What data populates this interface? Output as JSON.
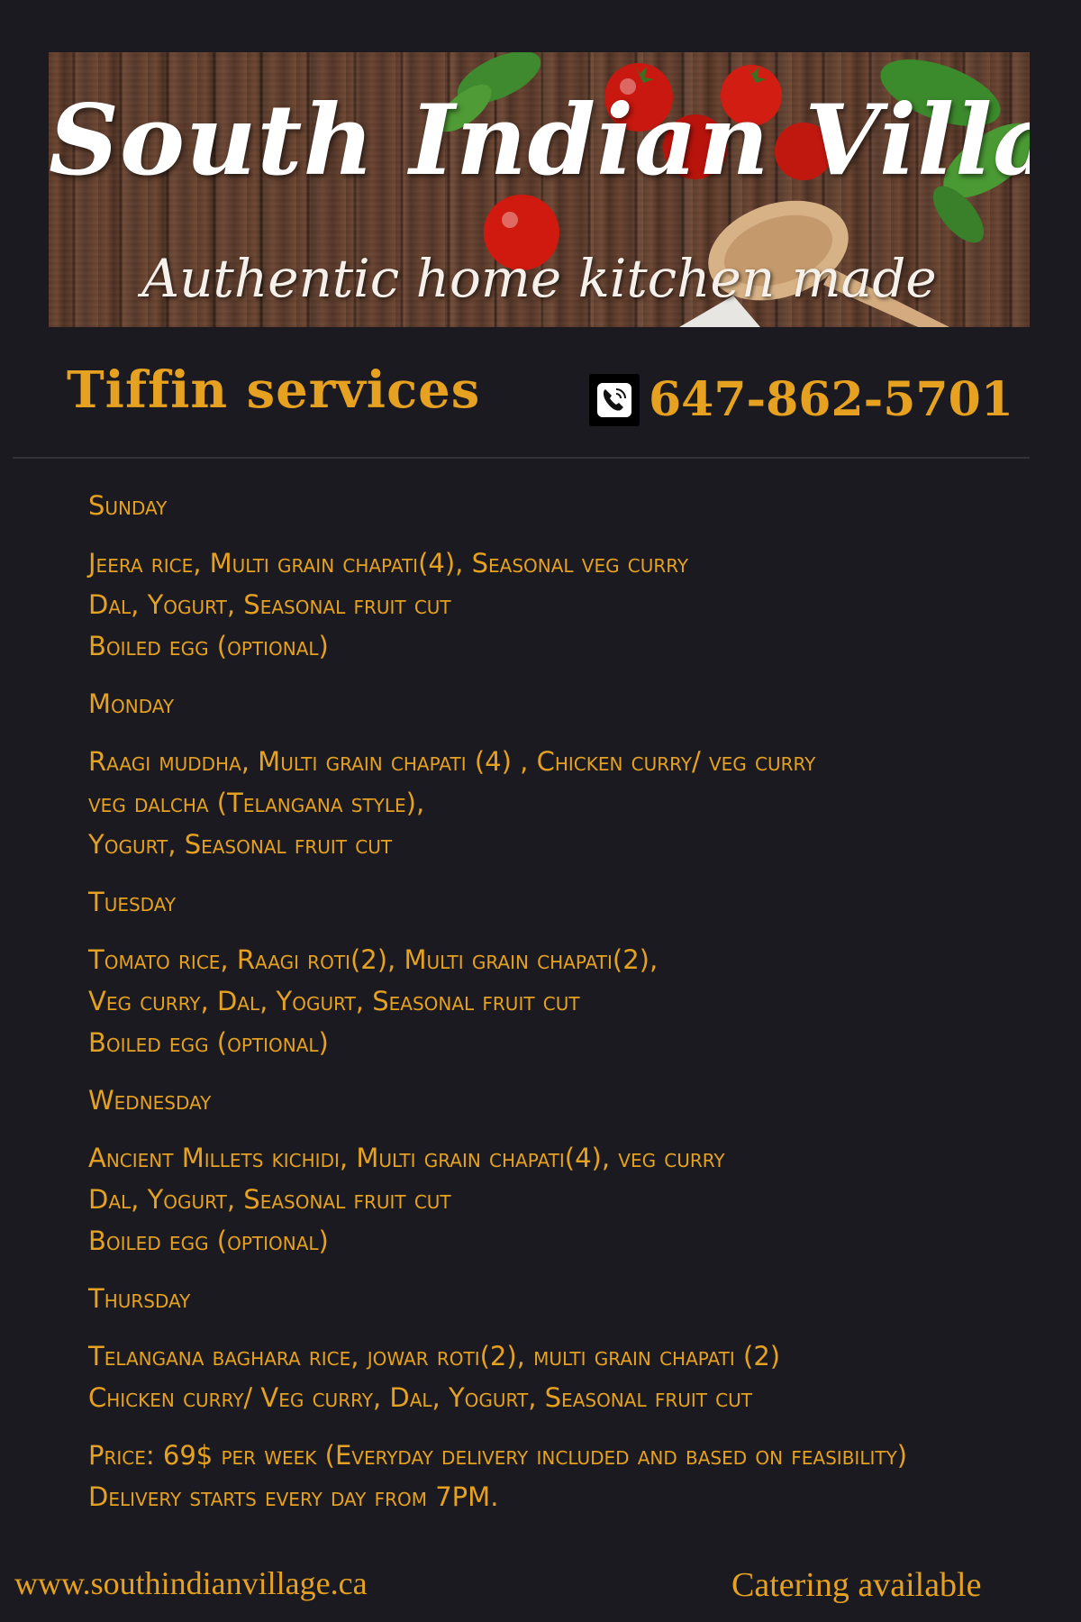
{
  "banner": {
    "title": "South Indian Village",
    "subtitle": "Authentic home kitchen made"
  },
  "header": {
    "service_title": "Tiffin services",
    "phone_number": "647-862-5701",
    "phone_icon": "phone-icon"
  },
  "menu": {
    "days": [
      {
        "name": "Sunday",
        "lines": [
          "Jeera rice, Multi grain chapati(4), Seasonal veg curry",
          "Dal, Yogurt, Seasonal fruit cut",
          "Boiled egg (optional)"
        ]
      },
      {
        "name": "Monday",
        "lines": [
          "Raagi muddha, Multi grain chapati (4) , Chicken curry/ veg curry",
          "veg dalcha (Telangana style),",
          "Yogurt, Seasonal fruit cut"
        ]
      },
      {
        "name": "Tuesday",
        "lines": [
          "Tomato rice, Raagi roti(2), Multi grain chapati(2),",
          "Veg curry, Dal, Yogurt, Seasonal fruit cut",
          "Boiled egg (optional)"
        ]
      },
      {
        "name": "Wednesday",
        "lines": [
          "Ancient Millets kichidi, Multi grain chapati(4), veg curry",
          "Dal, Yogurt, Seasonal fruit cut",
          "Boiled egg (optional)"
        ]
      },
      {
        "name": "Thursday",
        "lines": [
          "Telangana baghara rice, jowar roti(2), multi grain chapati (2)",
          "Chicken curry/ Veg curry, Dal, Yogurt, Seasonal fruit cut"
        ]
      }
    ],
    "price_line": "Price: 69$ per week (Everyday delivery included and based on feasibility)",
    "delivery_line": "Delivery starts every day from 7PM."
  },
  "footer": {
    "website": "www.southindianvillage.ca",
    "catering": "Catering available"
  },
  "colors": {
    "background": "#1b1a20",
    "accent": "#e5a11f",
    "banner_text": "#ffffff"
  }
}
